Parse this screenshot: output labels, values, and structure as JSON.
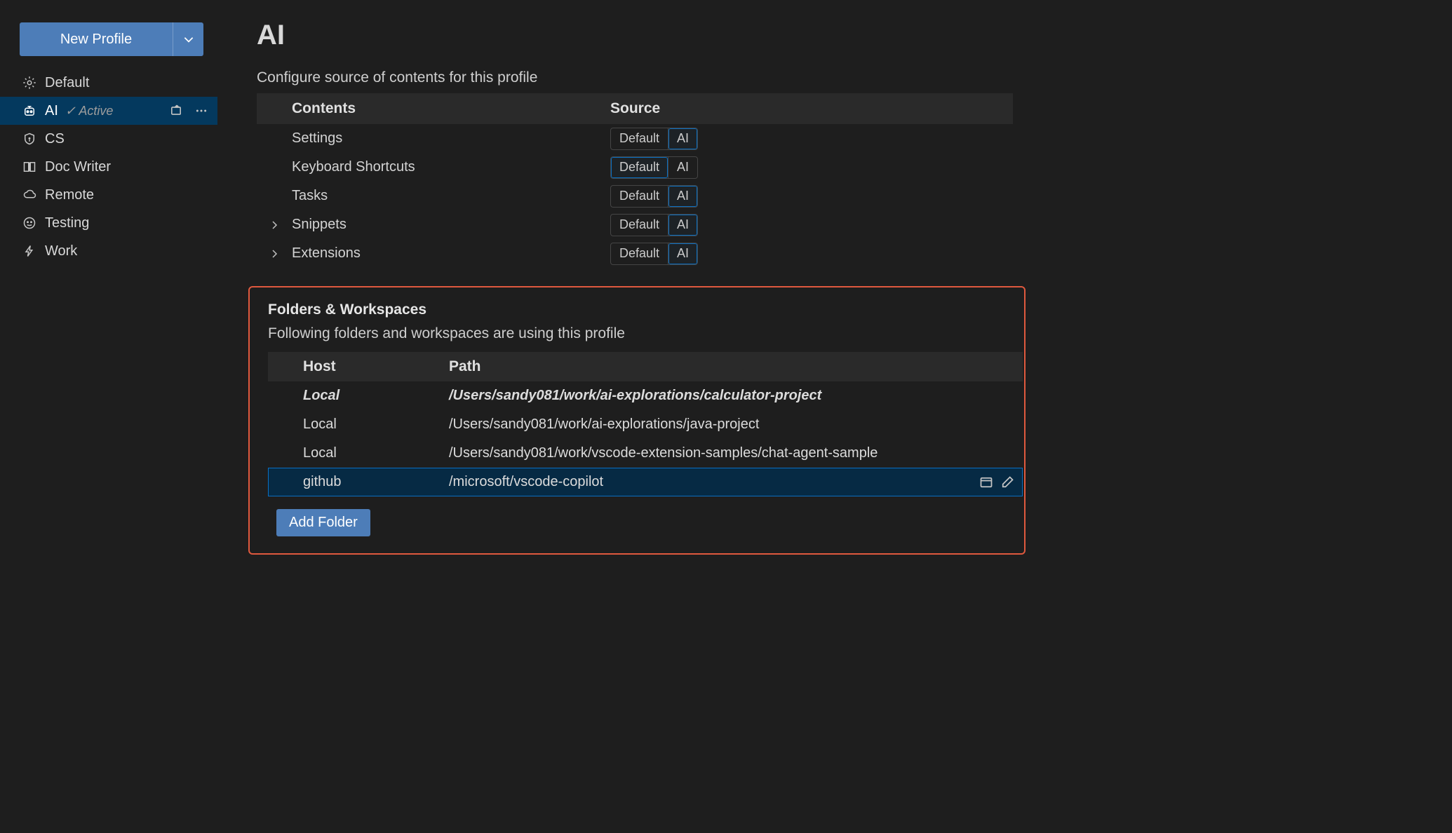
{
  "sidebar": {
    "new_profile_label": "New Profile",
    "profiles": [
      {
        "label": "Default",
        "icon": "gear-icon"
      },
      {
        "label": "AI",
        "icon": "robot-icon",
        "status_glyph": "✓",
        "status": "Active",
        "selected": true,
        "has_actions": true
      },
      {
        "label": "CS",
        "icon": "shield-icon"
      },
      {
        "label": "Doc Writer",
        "icon": "book-icon"
      },
      {
        "label": "Remote",
        "icon": "cloud-icon"
      },
      {
        "label": "Testing",
        "icon": "smiley-icon"
      },
      {
        "label": "Work",
        "icon": "lightning-icon"
      }
    ]
  },
  "main": {
    "title": "AI",
    "contents_desc": "Configure source of contents for this profile",
    "contents_table": {
      "header_contents": "Contents",
      "header_source": "Source",
      "rows": [
        {
          "name": "Settings",
          "expandable": false,
          "options": [
            "Default",
            "AI"
          ],
          "active_idx": 1
        },
        {
          "name": "Keyboard Shortcuts",
          "expandable": false,
          "options": [
            "Default",
            "AI"
          ],
          "active_idx": 0
        },
        {
          "name": "Tasks",
          "expandable": false,
          "options": [
            "Default",
            "AI"
          ],
          "active_idx": 1
        },
        {
          "name": "Snippets",
          "expandable": true,
          "options": [
            "Default",
            "AI"
          ],
          "active_idx": 1
        },
        {
          "name": "Extensions",
          "expandable": true,
          "options": [
            "Default",
            "AI"
          ],
          "active_idx": 1
        }
      ]
    },
    "folders": {
      "title": "Folders & Workspaces",
      "desc": "Following folders and workspaces are using this profile",
      "header_host": "Host",
      "header_path": "Path",
      "rows": [
        {
          "host": "Local",
          "path": "/Users/sandy081/work/ai-explorations/calculator-project",
          "italic": true
        },
        {
          "host": "Local",
          "path": "/Users/sandy081/work/ai-explorations/java-project"
        },
        {
          "host": "Local",
          "path": "/Users/sandy081/work/vscode-extension-samples/chat-agent-sample"
        },
        {
          "host": "github",
          "path": "/microsoft/vscode-copilot",
          "selected": true,
          "has_actions": true
        }
      ],
      "add_label": "Add Folder"
    }
  }
}
